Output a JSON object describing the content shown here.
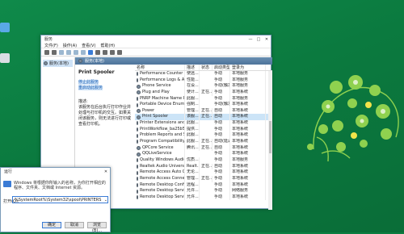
{
  "services_window": {
    "title": "服务",
    "menu": [
      "文件(F)",
      "操作(A)",
      "查看(V)",
      "帮助(H)"
    ],
    "tree_item": "服务(本地)",
    "header": "服务(本地)",
    "selected_service": "Print Spooler",
    "stop_link": "停止此服务",
    "restart_link": "重启动此服务",
    "desc_label": "描述:",
    "desc_text": "该服务在后台执行打印作业并处理与打印机的交互。如果关闭该服务，则无法进行打印或查看打印机。",
    "columns": [
      "名称",
      "描述",
      "状态",
      "启动类型",
      "登录为"
    ],
    "rows": [
      {
        "name": "Performance Counter DLL ...",
        "desc": "使远...",
        "status": "",
        "start": "手动",
        "logon": "本地服务"
      },
      {
        "name": "Performance Logs & Alerts",
        "desc": "性能...",
        "status": "",
        "start": "手动",
        "logon": "本地服务"
      },
      {
        "name": "Phone Service",
        "desc": "在设...",
        "status": "",
        "start": "手动(触发...",
        "logon": "本地服务"
      },
      {
        "name": "Plug and Play",
        "desc": "使计...",
        "status": "正在...",
        "start": "手动",
        "logon": "本地系统"
      },
      {
        "name": "PNRP Machine Name Publi...",
        "desc": "此服...",
        "status": "",
        "start": "手动",
        "logon": "本地服务"
      },
      {
        "name": "Portable Device Enumerat...",
        "desc": "强制...",
        "status": "",
        "start": "手动(触发...",
        "logon": "本地系统"
      },
      {
        "name": "Power",
        "desc": "管理...",
        "status": "正在...",
        "start": "自动",
        "logon": "本地系统"
      },
      {
        "name": "Print Spooler",
        "desc": "该服...",
        "status": "正在...",
        "start": "自动",
        "logon": "本地系统"
      },
      {
        "name": "Printer Extensions and Not...",
        "desc": "此服...",
        "status": "",
        "start": "手动",
        "logon": "本地系统"
      },
      {
        "name": "PrintWorkflow_ba25b59",
        "desc": "提供...",
        "status": "",
        "start": "手动",
        "logon": "本地系统"
      },
      {
        "name": "Problem Reports and Soluti...",
        "desc": "此服...",
        "status": "",
        "start": "手动",
        "logon": "本地系统"
      },
      {
        "name": "Program Compatibility Assi...",
        "desc": "此服...",
        "status": "正在...",
        "start": "自动(延迟...",
        "logon": "本地系统"
      },
      {
        "name": "QPCore Service",
        "desc": "腾讯...",
        "status": "正在...",
        "start": "自动",
        "logon": "本地系统"
      },
      {
        "name": "QQLiveService",
        "desc": "",
        "status": "",
        "start": "手动",
        "logon": "本地系统"
      },
      {
        "name": "Quality Windows Audio Vi...",
        "desc": "优质...",
        "status": "",
        "start": "手动",
        "logon": "本地服务"
      },
      {
        "name": "Realtek Audio Universal Se...",
        "desc": "Realt...",
        "status": "正在...",
        "start": "自动",
        "logon": "本地系统"
      },
      {
        "name": "Remote Access Auto Conne...",
        "desc": "无论...",
        "status": "",
        "start": "手动",
        "logon": "本地系统"
      },
      {
        "name": "Remote Access Connection...",
        "desc": "管理...",
        "status": "正在...",
        "start": "手动",
        "logon": "本地系统"
      },
      {
        "name": "Remote Desktop Configurat...",
        "desc": "远程...",
        "status": "",
        "start": "手动",
        "logon": "本地系统"
      },
      {
        "name": "Remote Desktop Services",
        "desc": "允许...",
        "status": "",
        "start": "手动",
        "logon": "网络服务"
      },
      {
        "name": "Remote Desktop Services U...",
        "desc": "允许...",
        "status": "",
        "start": "手动",
        "logon": "本地系统"
      }
    ]
  },
  "run_dialog": {
    "title": "运行",
    "text": "Windows 将根据你所输入的名称，为你打开相应的程序、文件夹、文档或 Internet 资源。",
    "open_label": "打开(O):",
    "value": "%SystemRoot%\\System32\\spool\\PRINTERS",
    "ok": "确定",
    "cancel": "取消",
    "browse": "浏览(B)..."
  },
  "colors": {
    "accent": "#3a7bd5",
    "desktop": "#0b7a3f",
    "bulb": "#8fd14f"
  }
}
